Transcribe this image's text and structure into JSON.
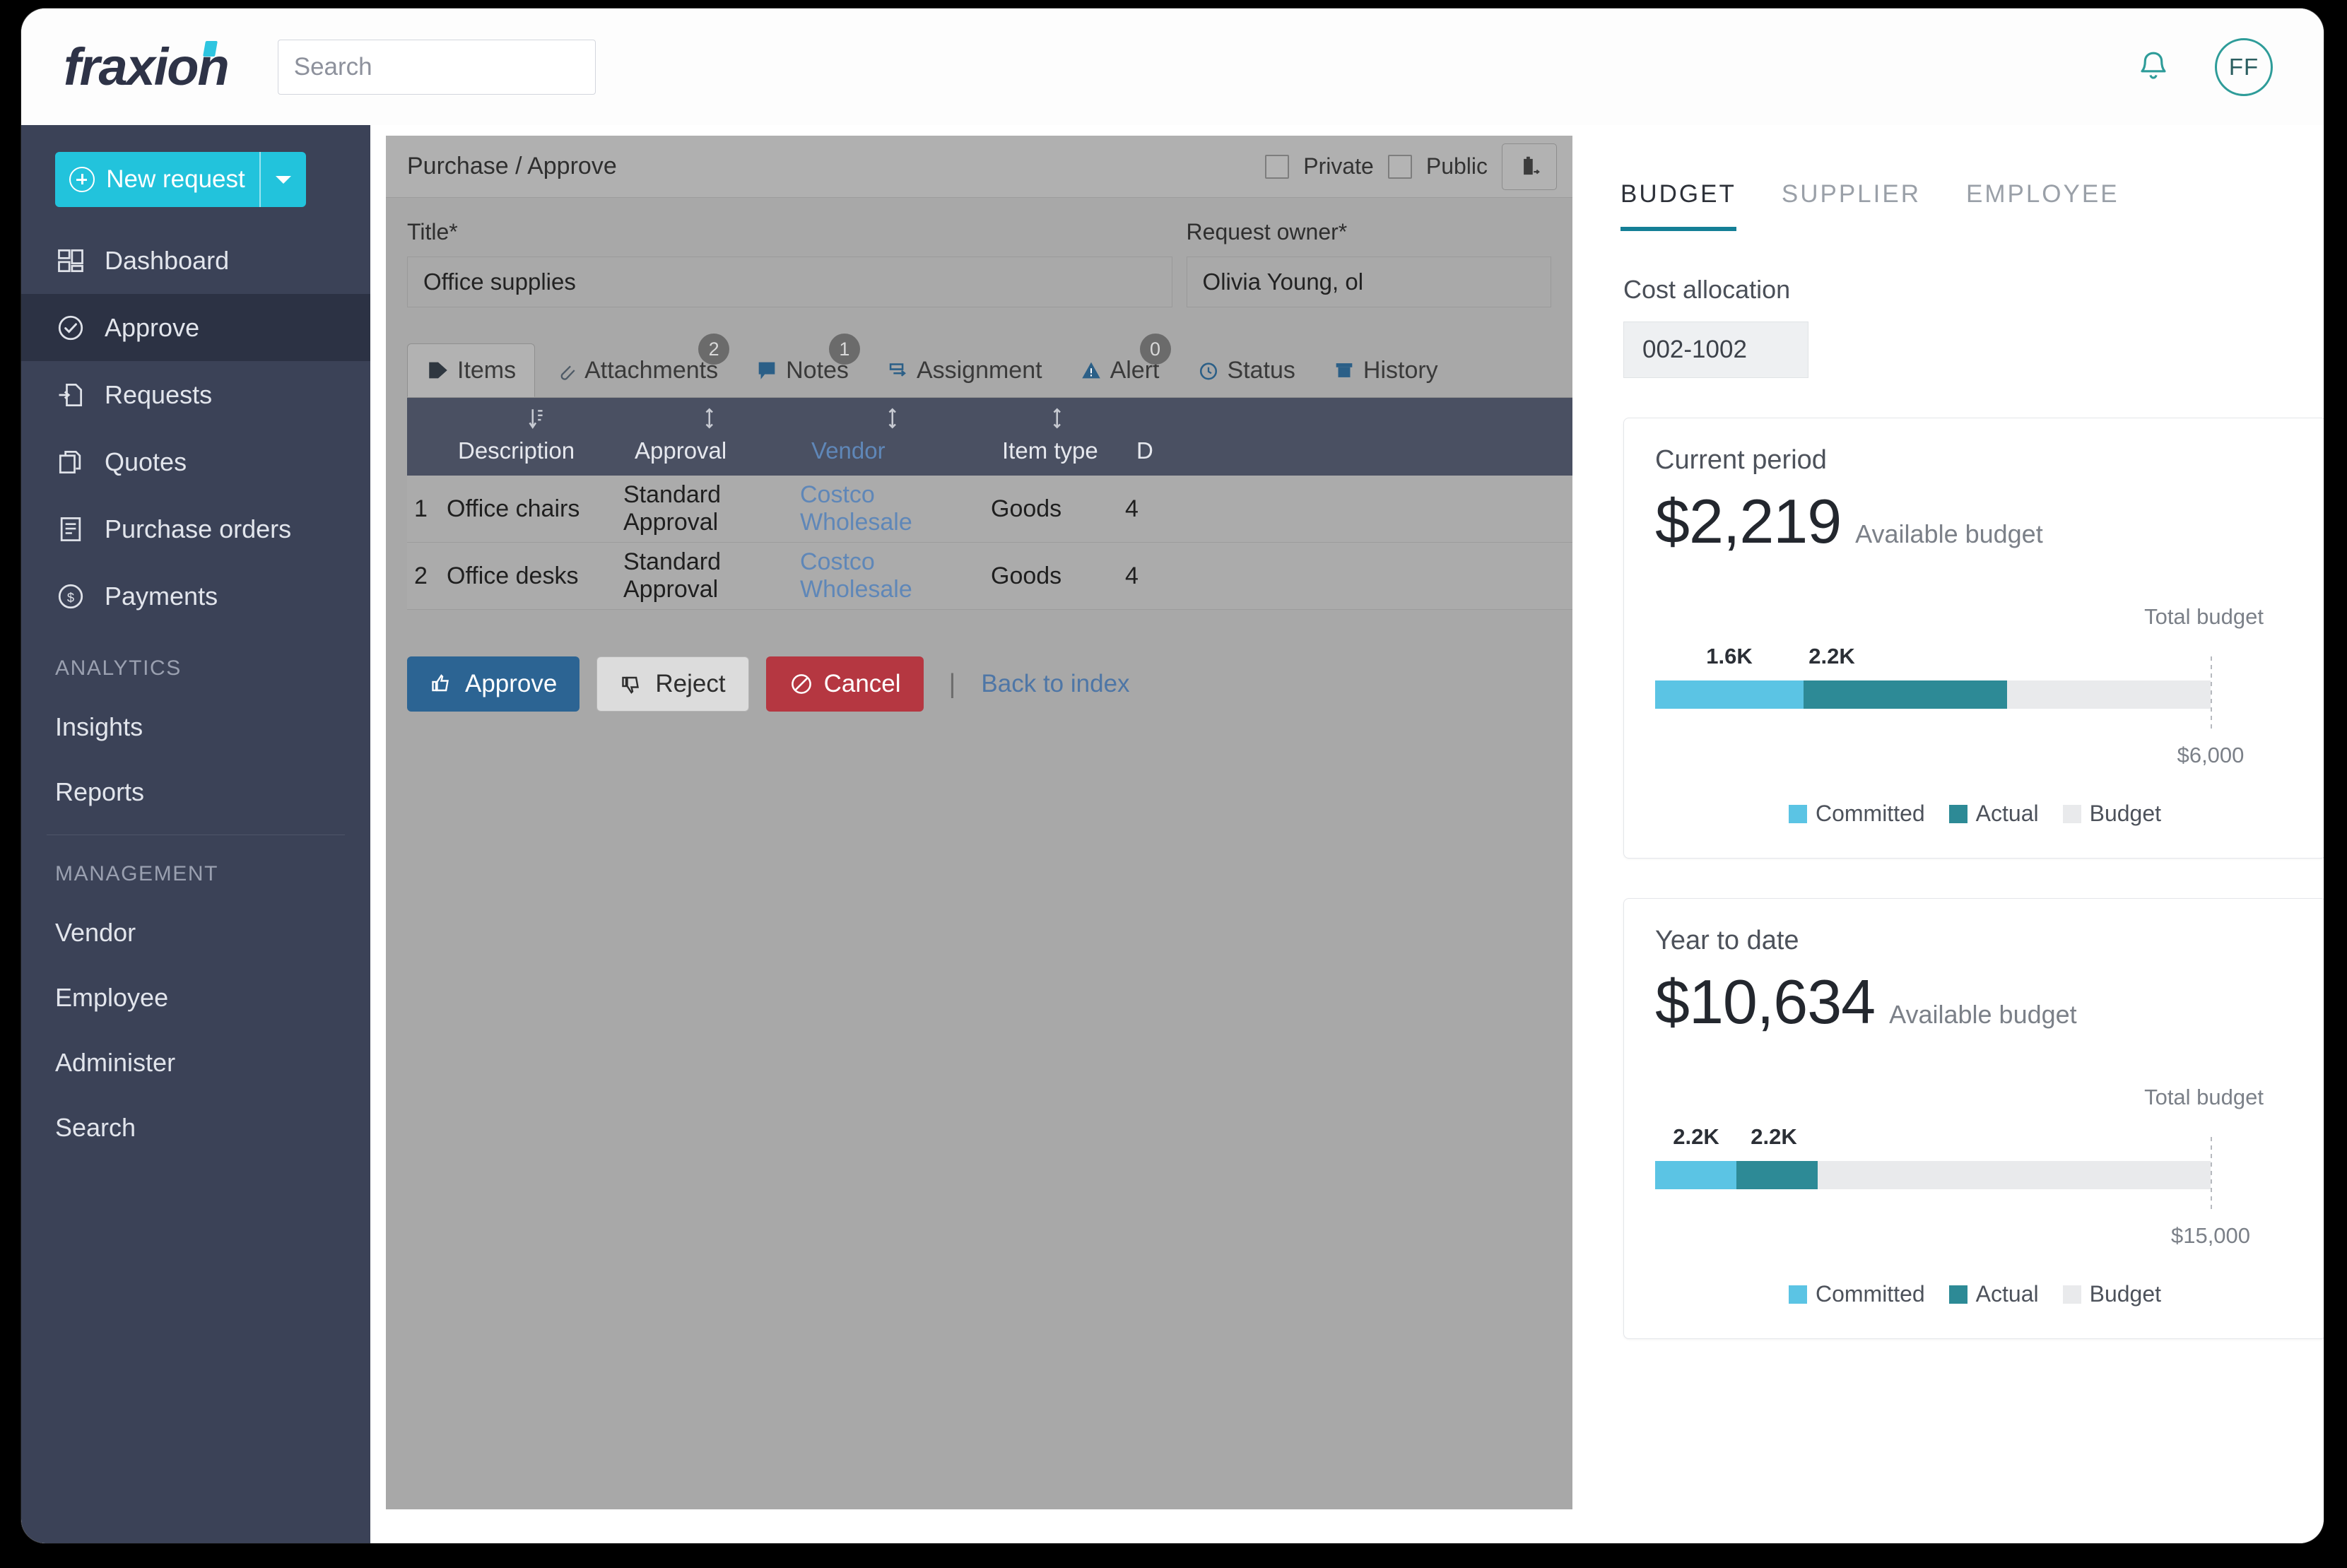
{
  "brand": {
    "name": "fraxion"
  },
  "topbar": {
    "search": {
      "placeholder": "Search",
      "value": ""
    },
    "notifications_icon": "bell-icon",
    "avatar_initials": "FF"
  },
  "sidebar": {
    "new_request": {
      "label": "New request",
      "caret": "chevron-down-icon"
    },
    "items": [
      {
        "label": "Dashboard",
        "icon": "dashboard-icon",
        "active": false
      },
      {
        "label": "Approve",
        "icon": "check-circle-icon",
        "active": true
      },
      {
        "label": "Requests",
        "icon": "request-doc-icon",
        "active": false
      },
      {
        "label": "Quotes",
        "icon": "copy-docs-icon",
        "active": false
      },
      {
        "label": "Purchase orders",
        "icon": "order-doc-icon",
        "active": false
      },
      {
        "label": "Payments",
        "icon": "dollar-circle-icon",
        "active": false
      }
    ],
    "sections": [
      {
        "title": "ANALYTICS",
        "items": [
          {
            "label": "Insights"
          },
          {
            "label": "Reports"
          }
        ]
      },
      {
        "title": "MANAGEMENT",
        "items": [
          {
            "label": "Vendor"
          },
          {
            "label": "Employee"
          },
          {
            "label": "Administer"
          },
          {
            "label": "Search"
          }
        ]
      }
    ]
  },
  "main": {
    "breadcrumb": "Purchase / Approve",
    "visibility": {
      "private_label": "Private",
      "public_label": "Public",
      "private_checked": false,
      "public_checked": false
    },
    "attach_button_icon": "add-attachment-icon",
    "fields": [
      {
        "label": "Title*",
        "value": "Office supplies"
      },
      {
        "label": "Request owner*",
        "value": "Olivia Young, ol"
      }
    ],
    "tabs": [
      {
        "label": "Items",
        "icon": "tag-icon",
        "badge": null,
        "active": true
      },
      {
        "label": "Attachments",
        "icon": "paperclip-icon",
        "badge": "2",
        "active": false
      },
      {
        "label": "Notes",
        "icon": "note-icon",
        "badge": "1",
        "active": false
      },
      {
        "label": "Assignment",
        "icon": "assignment-icon",
        "badge": null,
        "active": false
      },
      {
        "label": "Alert",
        "icon": "warning-icon",
        "badge": "0",
        "active": false
      },
      {
        "label": "Status",
        "icon": "clock-icon",
        "badge": null,
        "active": false
      },
      {
        "label": "History",
        "icon": "archive-icon",
        "badge": null,
        "active": false
      }
    ],
    "table": {
      "columns": [
        "",
        "Description",
        "Approval",
        "Vendor",
        "Item type",
        "D"
      ],
      "rows": [
        {
          "no": "1",
          "description": "Office chairs",
          "approval": "Standard Approval",
          "vendor": "Costco Wholesale",
          "item_type": "Goods",
          "last": "4"
        },
        {
          "no": "2",
          "description": "Office desks",
          "approval": "Standard Approval",
          "vendor": "Costco Wholesale",
          "item_type": "Goods",
          "last": "4"
        }
      ]
    },
    "actions": {
      "approve": "Approve",
      "reject": "Reject",
      "cancel": "Cancel",
      "separator": "|",
      "back": "Back to index"
    }
  },
  "right_panel": {
    "tabs": [
      {
        "label": "BUDGET",
        "active": true
      },
      {
        "label": "SUPPLIER",
        "active": false
      },
      {
        "label": "EMPLOYEE",
        "active": false
      }
    ],
    "cost_allocation": {
      "label": "Cost allocation",
      "value": "002-1002"
    },
    "legend": {
      "committed": "Committed",
      "actual": "Actual",
      "budget": "Budget"
    },
    "total_budget_label": "Total budget",
    "available_label": "Available budget"
  },
  "chart_data": [
    {
      "type": "bar",
      "title": "Current period",
      "available_budget": "$2,219",
      "available_budget_value": 2219,
      "total_budget": "$6,000",
      "total_budget_value": 6000,
      "categories": [
        "Committed",
        "Actual",
        "Budget"
      ],
      "series": [
        {
          "name": "Committed",
          "value": 1600,
          "label": "1.6K",
          "color": "#5bc4e4"
        },
        {
          "name": "Actual",
          "value": 2200,
          "label": "2.2K",
          "color": "#2d8a96"
        },
        {
          "name": "Budget",
          "value": 6000,
          "label": "",
          "color": "#e9eaec"
        }
      ],
      "orientation": "horizontal",
      "stacked": true,
      "xlim": [
        0,
        6000
      ],
      "grid": false,
      "legend_position": "bottom"
    },
    {
      "type": "bar",
      "title": "Year to date",
      "available_budget": "$10,634",
      "available_budget_value": 10634,
      "total_budget": "$15,000",
      "total_budget_value": 15000,
      "categories": [
        "Committed",
        "Actual",
        "Budget"
      ],
      "series": [
        {
          "name": "Committed",
          "value": 2200,
          "label": "2.2K",
          "color": "#5bc4e4"
        },
        {
          "name": "Actual",
          "value": 2200,
          "label": "2.2K",
          "color": "#2d8a96"
        },
        {
          "name": "Budget",
          "value": 15000,
          "label": "",
          "color": "#e9eaec"
        }
      ],
      "orientation": "horizontal",
      "stacked": true,
      "xlim": [
        0,
        15000
      ],
      "grid": false,
      "legend_position": "bottom"
    }
  ],
  "colors": {
    "accent_cyan": "#22c3dc",
    "sidebar": "#3b4257",
    "teal": "#147f96",
    "committed": "#5bc4e4",
    "actual": "#2d8a96",
    "budget_track": "#e9eaec",
    "approve": "#2c6493",
    "cancel": "#b53741"
  }
}
